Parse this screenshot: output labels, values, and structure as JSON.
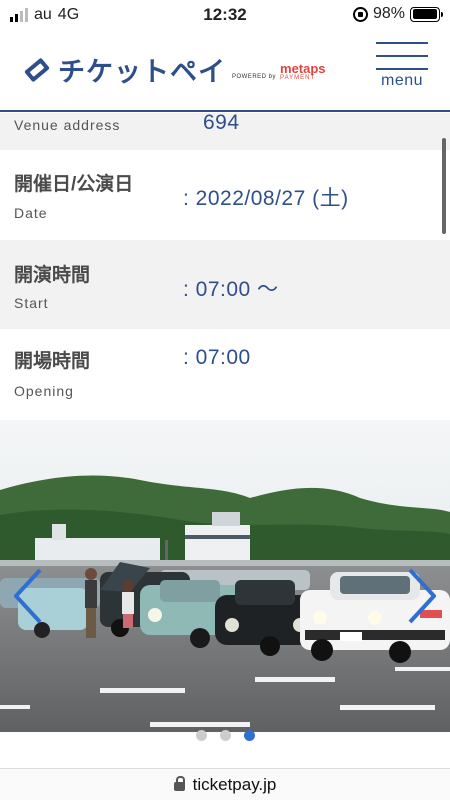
{
  "status_bar": {
    "carrier": "au",
    "network": "4G",
    "time": "12:32",
    "battery": "98%",
    "battery_level": 0.98
  },
  "header": {
    "logo_text": "チケットペイ",
    "powered_by": "POWERED by",
    "partner_top": "metaps",
    "partner_bottom": "PAYMENT",
    "menu_label": "menu",
    "accent_color": "#2e4f8a",
    "partner_color": "#e0443a"
  },
  "details": {
    "venue_address": {
      "en": "Venue address",
      "value": "694"
    },
    "date": {
      "jp": "開催日/公演日",
      "en": "Date",
      "value": ": 2022/08/27 (土)"
    },
    "start": {
      "jp": "開演時間",
      "en": "Start",
      "value": ": 07:00 〜"
    },
    "opening": {
      "jp": "開場時間",
      "en": "Opening",
      "value": ": 07:00"
    }
  },
  "carousel": {
    "slide_count": 3,
    "active_index": 2,
    "active_color": "#2f6fd1"
  },
  "url_bar": {
    "domain": "ticketpay.jp"
  }
}
